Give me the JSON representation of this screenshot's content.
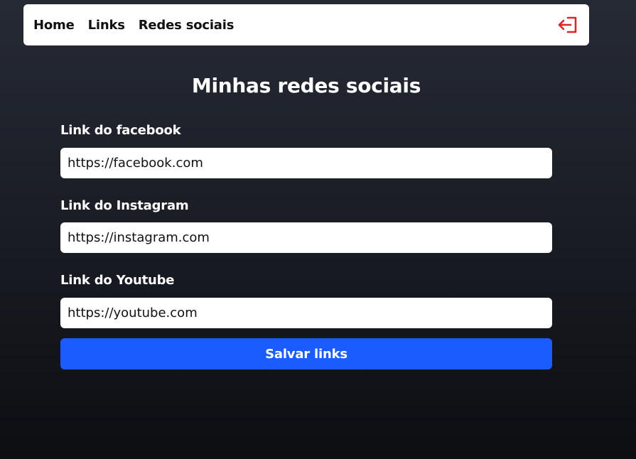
{
  "nav": {
    "links": [
      "Home",
      "Links",
      "Redes sociais"
    ],
    "logout_icon": "logout-icon",
    "logout_color": "#dc2626"
  },
  "page": {
    "title": "Minhas redes sociais"
  },
  "form": {
    "facebook": {
      "label": "Link do facebook",
      "value": "https://facebook.com"
    },
    "instagram": {
      "label": "Link do Instagram",
      "value": "https://instagram.com"
    },
    "youtube": {
      "label": "Link do Youtube",
      "value": "https://youtube.com"
    },
    "submit_label": "Salvar links",
    "submit_color": "#1a5cff"
  }
}
